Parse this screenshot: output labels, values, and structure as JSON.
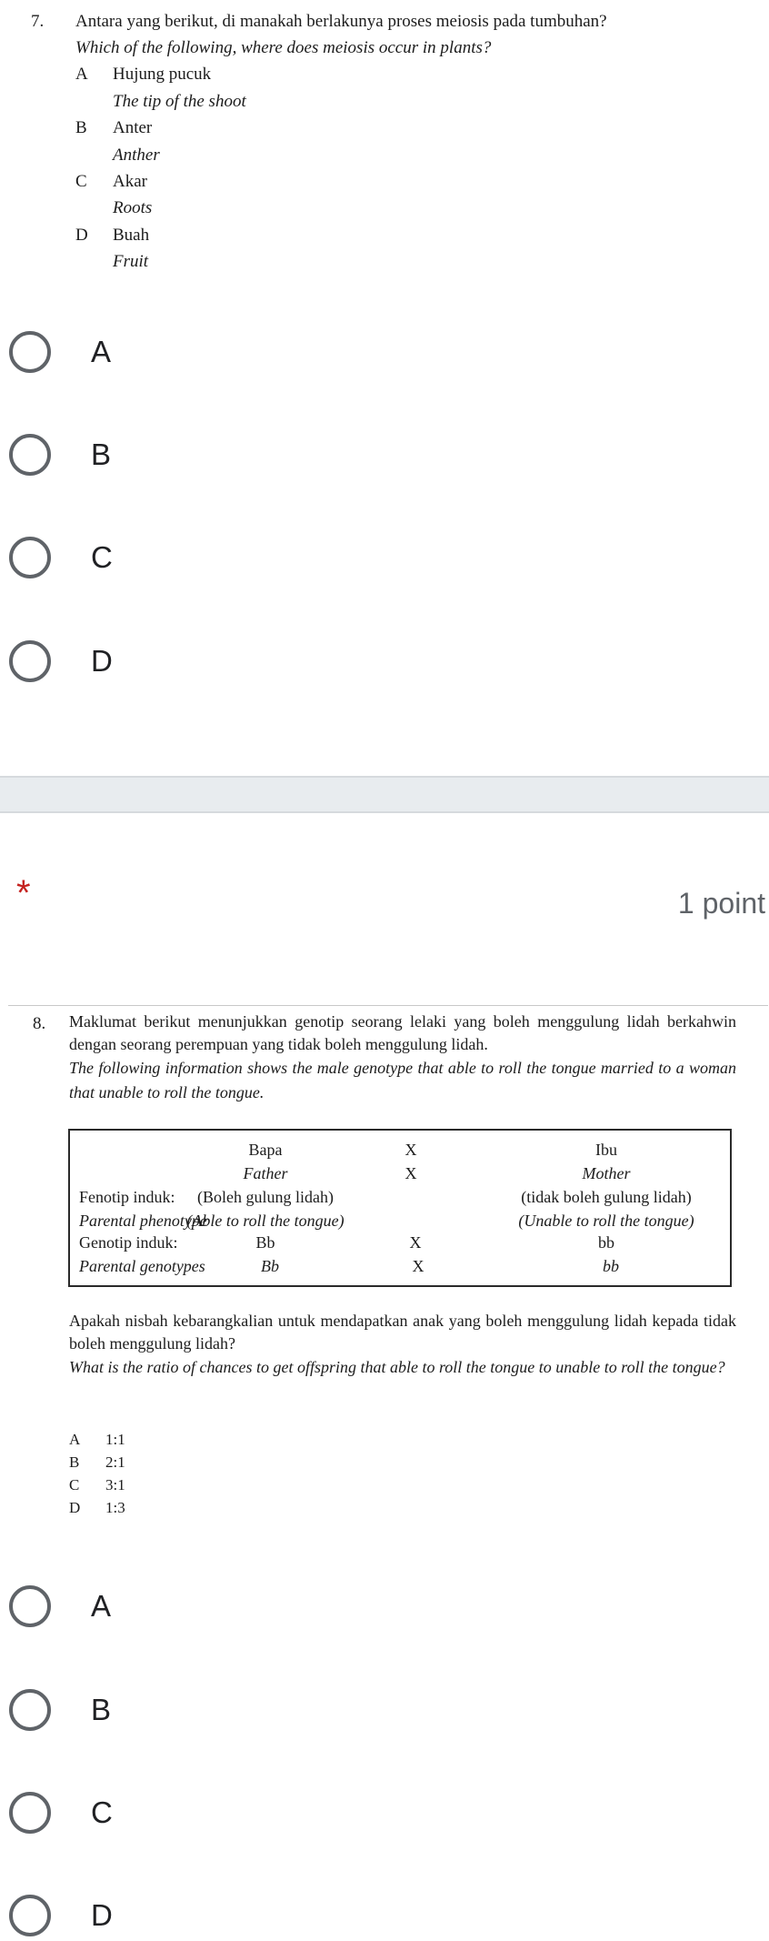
{
  "question7": {
    "number": "7.",
    "text_ms": "Antara yang berikut, di manakah berlakunya proses meiosis pada tumbuhan?",
    "text_en": "Which of the following, where does meiosis occur in plants?",
    "options": [
      {
        "letter": "A",
        "ms": "Hujung pucuk",
        "en": "The tip of the shoot"
      },
      {
        "letter": "B",
        "ms": "Anter",
        "en": "Anther"
      },
      {
        "letter": "C",
        "ms": "Akar",
        "en": "Roots"
      },
      {
        "letter": "D",
        "ms": "Buah",
        "en": "Fruit"
      }
    ],
    "choices": [
      "A",
      "B",
      "C",
      "D"
    ]
  },
  "question8_header": {
    "required_mark": "*",
    "points": "1 point"
  },
  "question8": {
    "number": "8.",
    "text_ms": "Maklumat berikut menunjukkan genotip seorang lelaki yang boleh menggulung lidah berkahwin dengan seorang perempuan yang tidak boleh menggulung lidah.",
    "text_en": "The following information shows the male genotype that able to roll the tongue married to a woman that unable to roll the tongue.",
    "table": {
      "father_ms": "Bapa",
      "father_en": "Father",
      "cross": "X",
      "mother_ms": "Ibu",
      "mother_en": "Mother",
      "phenotype_label_ms": "Fenotip induk:",
      "phenotype_label_en": "Parental phenotype",
      "father_phenotype_ms": "(Boleh gulung lidah)",
      "father_phenotype_en": "(Able to roll the tongue)",
      "mother_phenotype_ms": "(tidak boleh gulung lidah)",
      "mother_phenotype_en": "(Unable to roll the tongue)",
      "genotype_label_ms": "Genotip induk:",
      "genotype_label_en": "Parental genotypes",
      "father_genotype": "Bb",
      "mother_genotype": "bb"
    },
    "followup_ms": "Apakah nisbah kebarangkalian untuk mendapatkan anak yang boleh menggulung lidah kepada tidak boleh menggulung lidah?",
    "followup_en": "What is the ratio of chances to get offspring that able to roll the tongue to unable to roll the tongue?",
    "options": [
      {
        "letter": "A",
        "value": "1:1"
      },
      {
        "letter": "B",
        "value": "2:1"
      },
      {
        "letter": "C",
        "value": "3:1"
      },
      {
        "letter": "D",
        "value": "1:3"
      }
    ],
    "choices": [
      "A",
      "B",
      "C",
      "D"
    ]
  }
}
